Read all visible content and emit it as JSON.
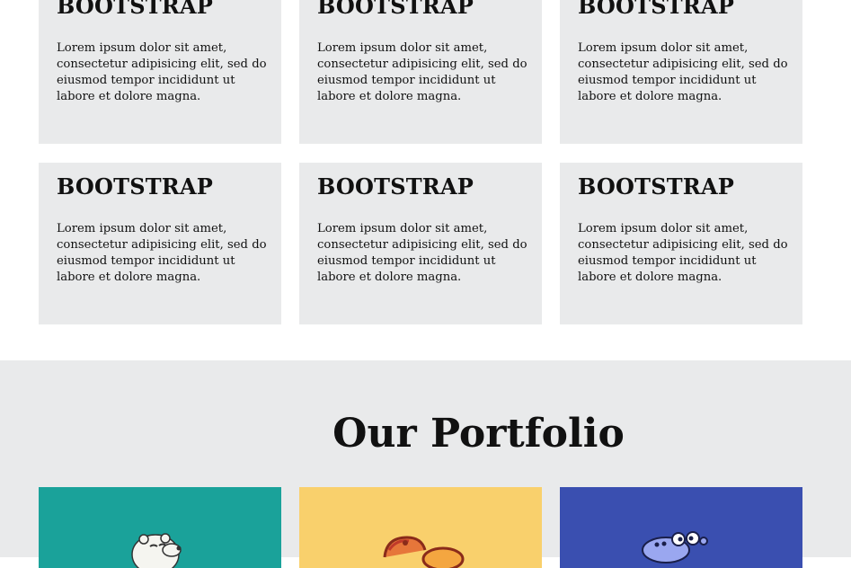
{
  "features": {
    "cards": [
      {
        "title": "BOOTSTRAP",
        "text": "Lorem ipsum dolor sit amet, consectetur adipisicing elit, sed do eiusmod tempor incididunt ut labore et dolore magna."
      },
      {
        "title": "BOOTSTRAP",
        "text": "Lorem ipsum dolor sit amet, consectetur adipisicing elit, sed do eiusmod tempor incididunt ut labore et dolore magna."
      },
      {
        "title": "BOOTSTRAP",
        "text": "Lorem ipsum dolor sit amet, consectetur adipisicing elit, sed do eiusmod tempor incididunt ut labore et dolore magna."
      },
      {
        "title": "BOOTSTRAP",
        "text": "Lorem ipsum dolor sit amet, consectetur adipisicing elit, sed do eiusmod tempor incididunt ut labore et dolore magna."
      },
      {
        "title": "BOOTSTRAP",
        "text": "Lorem ipsum dolor sit amet, consectetur adipisicing elit, sed do eiusmod tempor incididunt ut labore et dolore magna."
      },
      {
        "title": "BOOTSTRAP",
        "text": "Lorem ipsum dolor sit amet, consectetur adipisicing elit, sed do eiusmod tempor incididunt ut labore et dolore magna."
      }
    ]
  },
  "portfolio": {
    "heading": "Our Portfolio",
    "items": [
      {
        "icon": "polar-bear-cartoon-image",
        "bg": "#1aa29a"
      },
      {
        "icon": "cartoon-character-image",
        "bg": "#f9d06c"
      },
      {
        "icon": "hippo-cartoon-image",
        "bg": "#3a4fb0"
      }
    ]
  },
  "colors": {
    "section_bg": "#e9eaeb",
    "card_bg": "#e9eaeb",
    "text": "#111111"
  }
}
